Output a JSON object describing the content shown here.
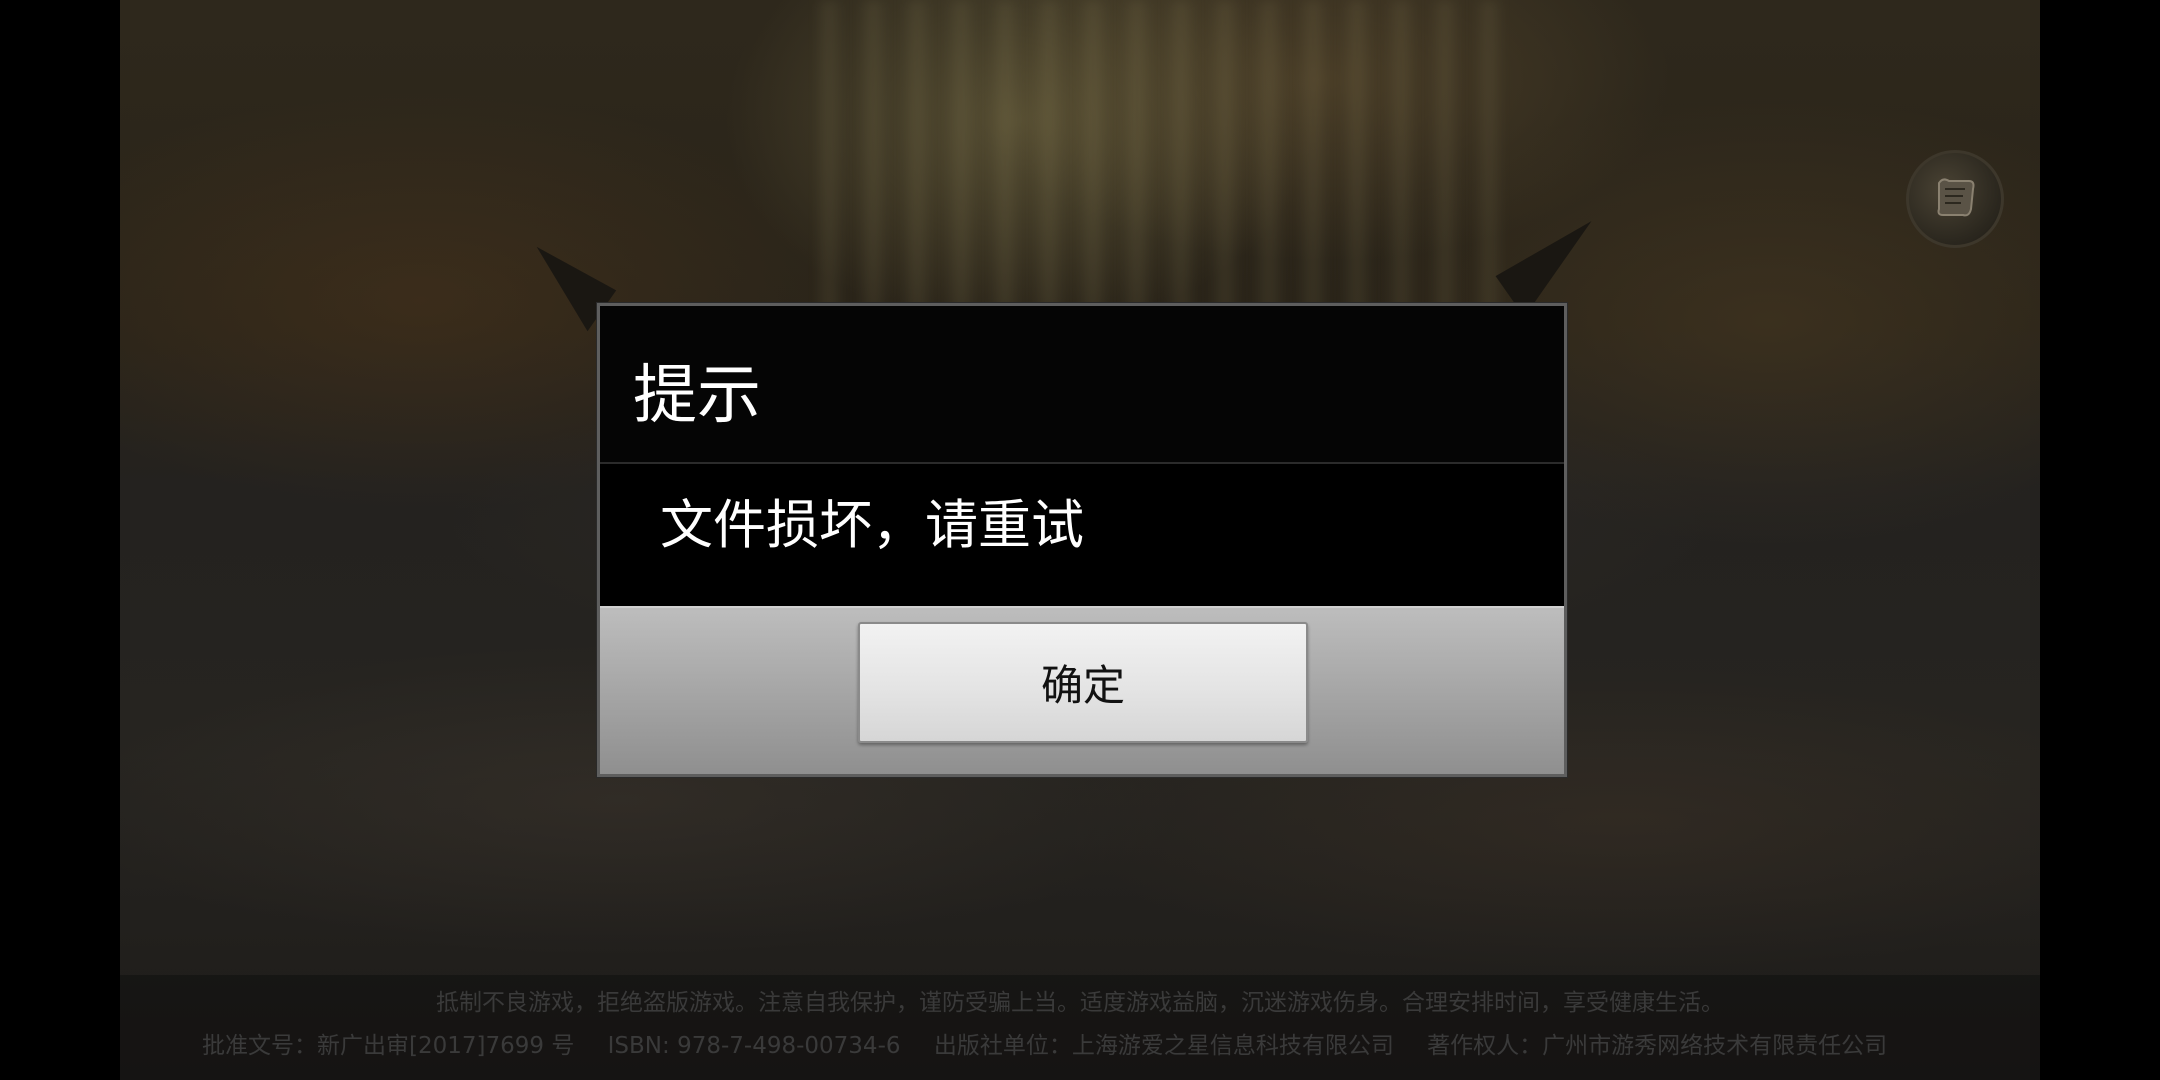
{
  "dialog": {
    "title": "提示",
    "message": "文件损坏，请重试",
    "ok_label": "确定"
  },
  "scroll_button": {
    "icon": "scroll-icon"
  },
  "notices": {
    "warning": "抵制不良游戏，拒绝盗版游戏。注意自我保护，谨防受骗上当。适度游戏益脑，沉迷游戏伤身。合理安排时间，享受健康生活。",
    "approval_number": "批准文号：新广出审[2017]7699 号",
    "isbn": "ISBN: 978-7-498-00734-6",
    "publisher": "出版社单位：上海游爱之星信息科技有限公司",
    "copyright_owner": "著作权人：广州市游秀网络技术有限责任公司"
  },
  "colors": {
    "dialog_background": "#000000",
    "dialog_border": "#5e5e5e",
    "footer_gray": "#a6a6a6",
    "button_face": "#e4e4e4",
    "notice_text": "#3a3a3a"
  }
}
